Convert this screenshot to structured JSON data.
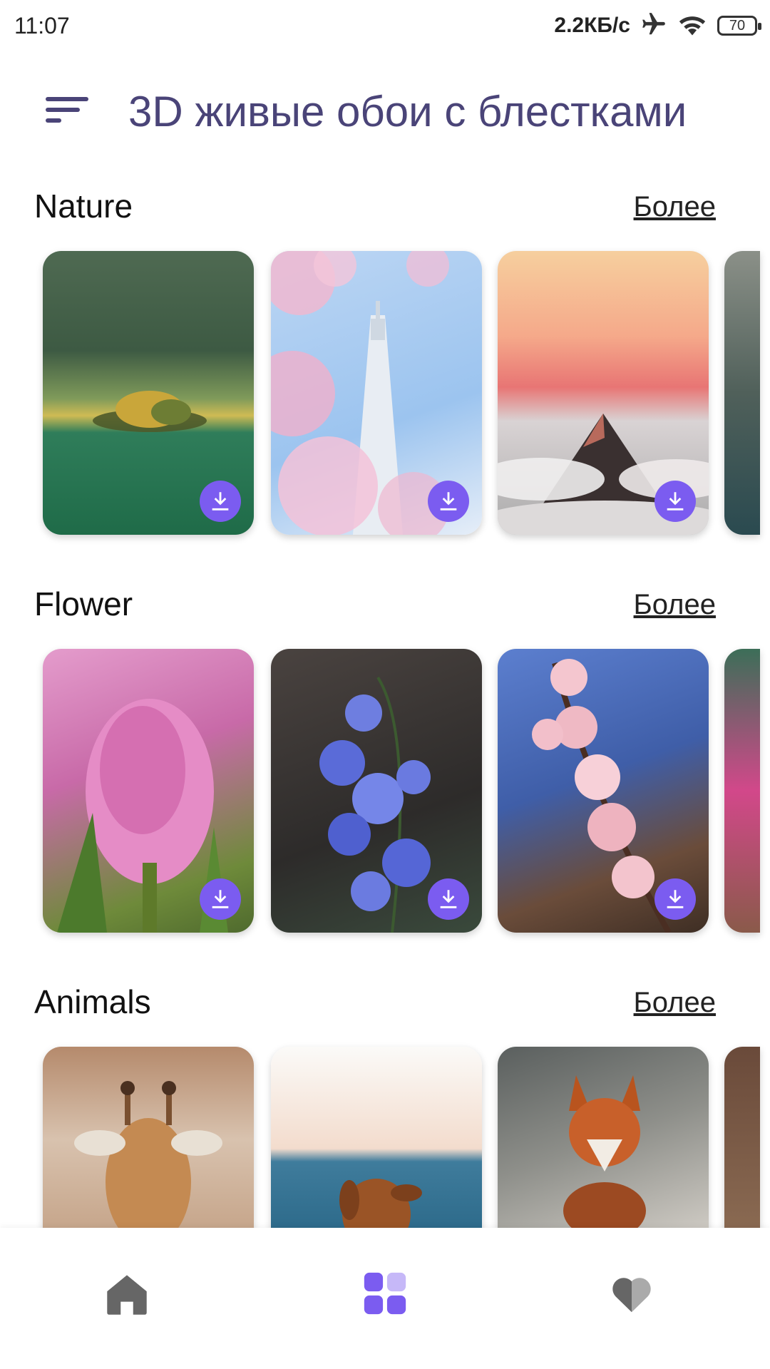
{
  "status_bar": {
    "time": "11:07",
    "net_speed": "2.2КБ/с",
    "battery": "70",
    "icons": [
      "airplane-icon",
      "wifi-icon",
      "battery-icon"
    ]
  },
  "header": {
    "title": "3D живые обои с блестками",
    "menu_icon": "menu-icon"
  },
  "colors": {
    "title": "#4a4478",
    "accent": "#7b5cf0",
    "nav_inactive": "#666666"
  },
  "sections": [
    {
      "title": "Nature",
      "more": "Более",
      "items": [
        "forest lake island",
        "cherry blossom tower",
        "mountain above clouds",
        "lake (partial)"
      ]
    },
    {
      "title": "Flower",
      "more": "Более",
      "items": [
        "pink hyacinth",
        "blue orchid",
        "cherry blossom branch",
        "pink flower (partial)"
      ]
    },
    {
      "title": "Animals",
      "more": "Более",
      "items": [
        "giraffe",
        "dog at sea",
        "fox",
        "animal (partial)"
      ]
    }
  ],
  "bottom_nav": [
    {
      "id": "home",
      "icon": "home-icon"
    },
    {
      "id": "categories",
      "icon": "grid-icon",
      "active": true
    },
    {
      "id": "favorites",
      "icon": "heart-icon"
    }
  ]
}
